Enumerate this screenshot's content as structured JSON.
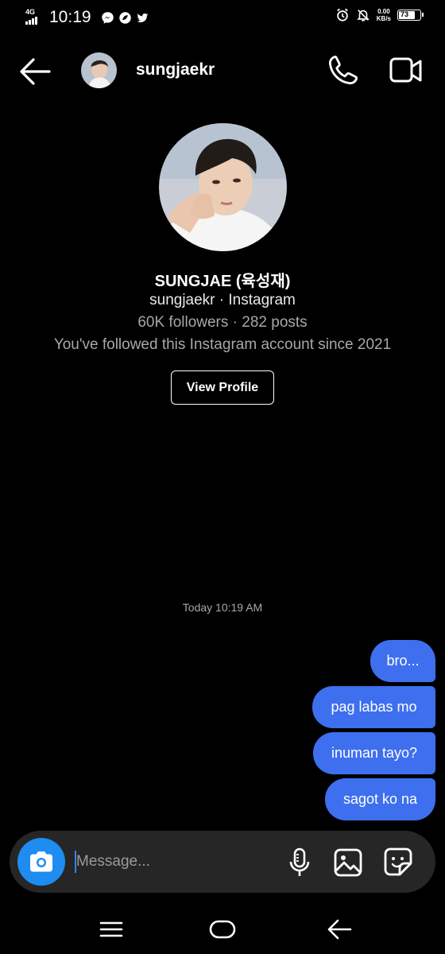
{
  "status_bar": {
    "network": "4G",
    "time": "10:19",
    "apps": [
      "messenger-icon",
      "app-icon",
      "twitter-icon"
    ],
    "speed_value": "0.00",
    "speed_unit": "KB/s",
    "battery": "73"
  },
  "header": {
    "username": "sungjaekr"
  },
  "profile": {
    "display_name": "SUNGJAE (육성재)",
    "handle_line": "sungjaekr · Instagram",
    "stats_line": "60K followers · 282 posts",
    "since_line": "You've followed this Instagram account since 2021",
    "view_profile_label": "View Profile"
  },
  "conversation": {
    "timestamp": "Today 10:19 AM",
    "messages": [
      {
        "text": "bro...",
        "sender": "me"
      },
      {
        "text": "pag labas mo",
        "sender": "me"
      },
      {
        "text": "inuman tayo?",
        "sender": "me"
      },
      {
        "text": "sagot ko na",
        "sender": "me"
      }
    ]
  },
  "composer": {
    "placeholder": "Message..."
  },
  "colors": {
    "background": "#000000",
    "bubble": "#3e6fee",
    "camera_button": "#1e8cf0",
    "composer": "#262626"
  }
}
